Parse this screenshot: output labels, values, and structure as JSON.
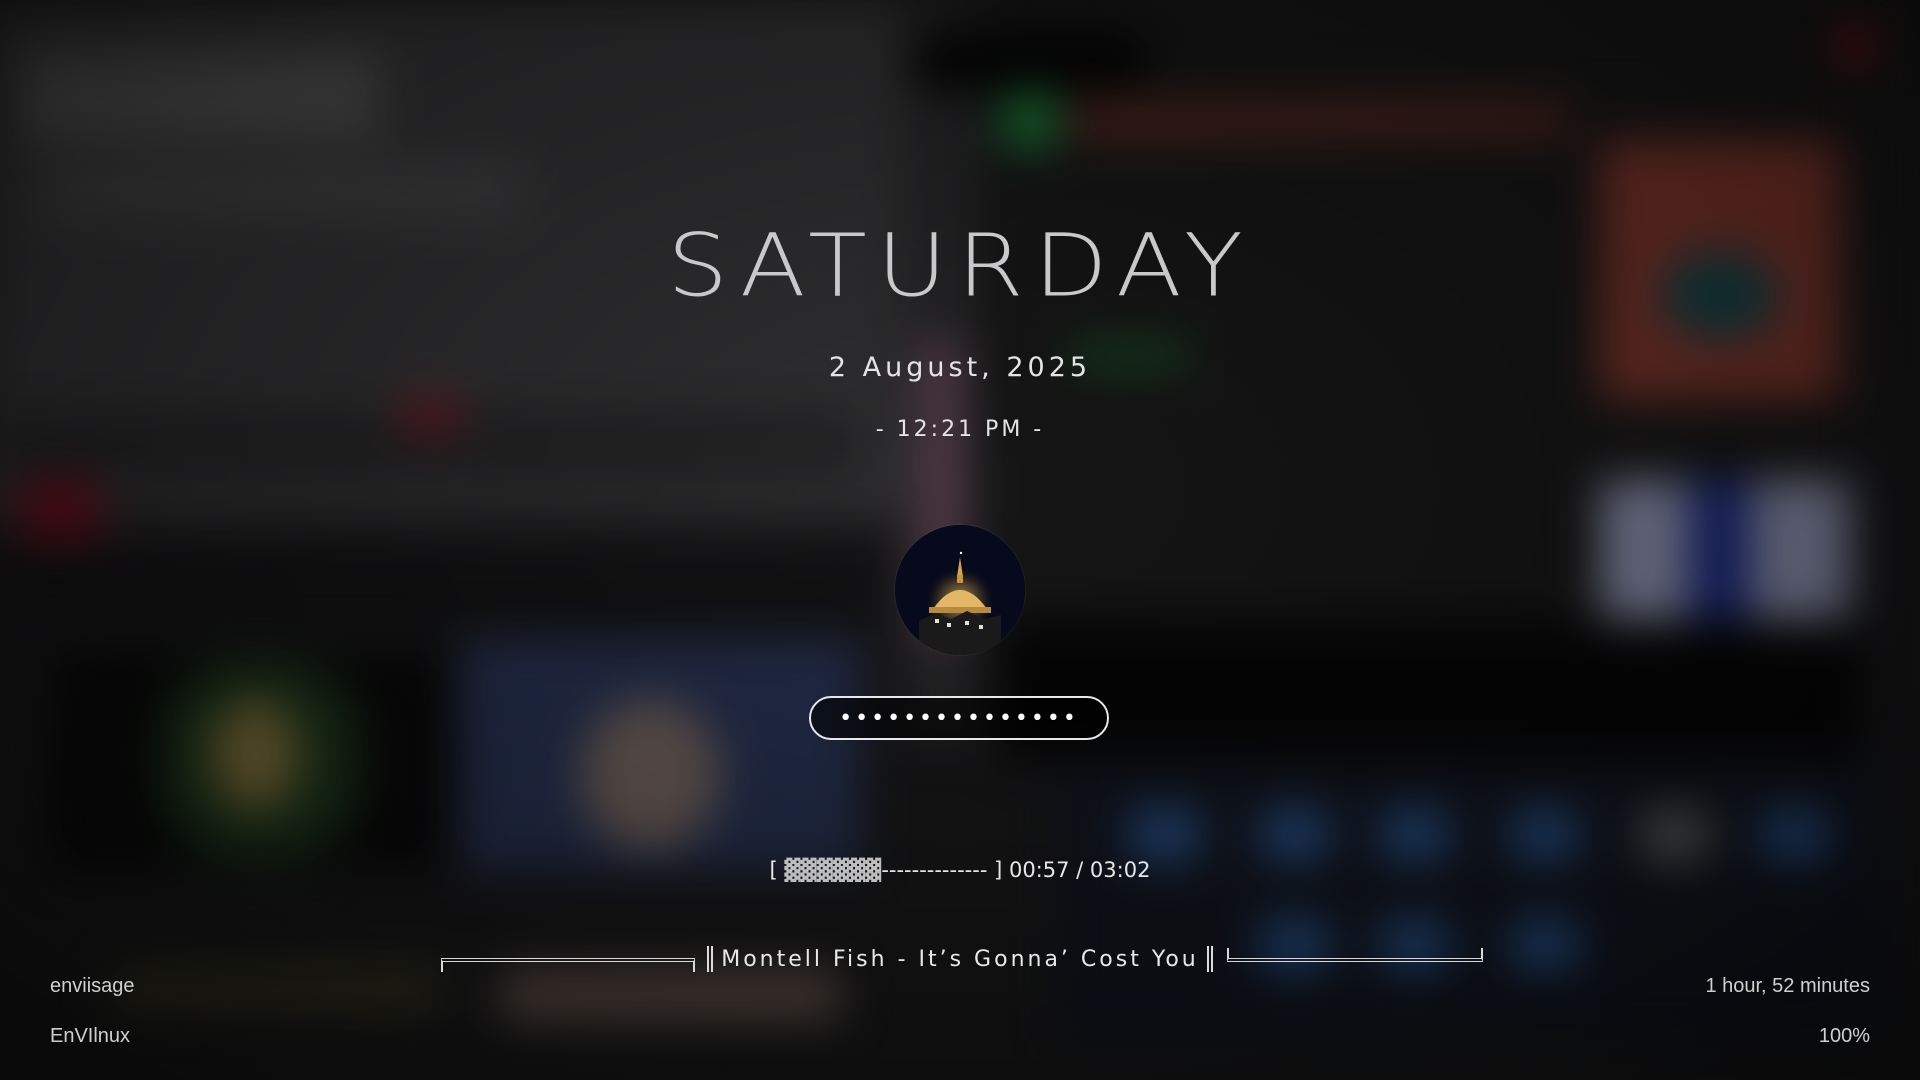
{
  "lockscreen": {
    "day": "SATURDAY",
    "date": "2 August, 2025",
    "time": "- 12:21 PM -",
    "password_masked": "•••••••••••••••",
    "media": {
      "progress_bracket_open": "[ ",
      "progress_fill": "▓▓▓▓▓▓",
      "progress_rest": "-------------- ] ",
      "elapsed": "00:57",
      "time_separator": " / ",
      "duration": "03:02",
      "track": "Montell Fish - It’s Gonna’ Cost You"
    },
    "bottom_left": {
      "username": "enviisage",
      "hostname": "EnVIlnux"
    },
    "bottom_right": {
      "uptime": "1 hour, 52 minutes",
      "battery": "100%"
    }
  },
  "icons": {
    "avatar": "user-avatar-temple-night",
    "separator": "double-bar-separator"
  },
  "colors": {
    "text": "#e6e6e6",
    "day": "#c9c9cb",
    "background": "#1b1b1d"
  }
}
